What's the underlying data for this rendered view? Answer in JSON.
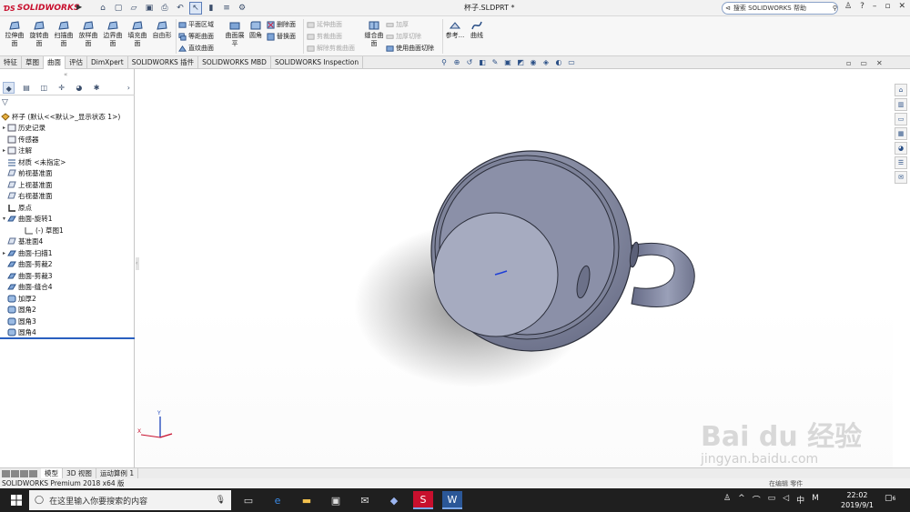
{
  "window": {
    "app_logo": "SOLIDWORKS",
    "doc_title": "杯子.SLDPRT *",
    "help_search_placeholder": "搜索 SOLIDWORKS 帮助"
  },
  "ribbon": {
    "big_buttons": [
      {
        "label": "拉伸曲面",
        "icon": "extrude-surface-icon"
      },
      {
        "label": "旋转曲面",
        "icon": "revolve-surface-icon"
      },
      {
        "label": "扫描曲面",
        "icon": "sweep-surface-icon"
      },
      {
        "label": "放样曲面",
        "icon": "loft-surface-icon"
      },
      {
        "label": "边界曲面",
        "icon": "boundary-surface-icon"
      },
      {
        "label": "填充曲面",
        "icon": "fill-surface-icon"
      },
      {
        "label": "自由形",
        "icon": "freeform-icon"
      }
    ],
    "col1": [
      "平面区域",
      "等距曲面",
      "直纹曲面"
    ],
    "big_mid": [
      {
        "label": "曲面展平",
        "icon": "flatten-surface-icon"
      },
      {
        "label": "圆角",
        "icon": "fillet-icon"
      }
    ],
    "col2": [
      "删除面",
      "替换面"
    ],
    "col3_disabled": [
      "延伸曲面",
      "剪裁曲面",
      "解除剪裁曲面"
    ],
    "big_knit": {
      "label": "缝合曲面",
      "icon": "knit-surface-icon"
    },
    "col4": [
      "加厚",
      "加厚切除",
      "使用曲面切除"
    ],
    "col4_disabled": [
      true,
      true,
      false
    ],
    "big_right": [
      {
        "label": "参考...",
        "icon": "reference-geometry-icon"
      },
      {
        "label": "曲线",
        "icon": "curves-icon"
      }
    ]
  },
  "tabs": [
    "特征",
    "草图",
    "曲面",
    "评估",
    "DimXpert",
    "SOLIDWORKS 插件",
    "SOLIDWORKS MBD",
    "SOLIDWORKS Inspection"
  ],
  "active_tab": "曲面",
  "feature_tree": {
    "root": "杯子 (默认<<默认>_显示状态 1>)",
    "nodes": [
      {
        "label": "历史记录",
        "expand": "▸",
        "indent": 1,
        "icon": "history-icon"
      },
      {
        "label": "传感器",
        "expand": "",
        "indent": 1,
        "icon": "sensor-icon"
      },
      {
        "label": "注解",
        "expand": "▸",
        "indent": 1,
        "icon": "annotation-icon"
      },
      {
        "label": "材质 <未指定>",
        "expand": "",
        "indent": 1,
        "icon": "material-icon"
      },
      {
        "label": "前视基准面",
        "expand": "",
        "indent": 1,
        "icon": "plane-icon"
      },
      {
        "label": "上视基准面",
        "expand": "",
        "indent": 1,
        "icon": "plane-icon"
      },
      {
        "label": "右视基准面",
        "expand": "",
        "indent": 1,
        "icon": "plane-icon"
      },
      {
        "label": "原点",
        "expand": "",
        "indent": 1,
        "icon": "origin-icon"
      },
      {
        "label": "曲面-旋转1",
        "expand": "▾",
        "indent": 1,
        "icon": "revolve-surface-icon"
      },
      {
        "label": "(-) 草图1",
        "expand": "",
        "indent": 2,
        "icon": "sketch-icon"
      },
      {
        "label": "基准面4",
        "expand": "",
        "indent": 1,
        "icon": "plane-icon"
      },
      {
        "label": "曲面-扫描1",
        "expand": "▸",
        "indent": 1,
        "icon": "sweep-surface-icon"
      },
      {
        "label": "曲面-剪裁2",
        "expand": "",
        "indent": 1,
        "icon": "trim-surface-icon"
      },
      {
        "label": "曲面-剪裁3",
        "expand": "",
        "indent": 1,
        "icon": "trim-surface-icon"
      },
      {
        "label": "曲面-缝合4",
        "expand": "",
        "indent": 1,
        "icon": "knit-surface-icon"
      },
      {
        "label": "加厚2",
        "expand": "",
        "indent": 1,
        "icon": "thicken-icon"
      },
      {
        "label": "圆角2",
        "expand": "",
        "indent": 1,
        "icon": "fillet-icon"
      },
      {
        "label": "圆角3",
        "expand": "",
        "indent": 1,
        "icon": "fillet-icon"
      },
      {
        "label": "圆角4",
        "expand": "",
        "indent": 1,
        "icon": "fillet-icon"
      }
    ]
  },
  "model_tabs": [
    "模型",
    "3D 视图",
    "运动算例 1"
  ],
  "active_model_tab": "模型",
  "status_bar": {
    "text": "SOLIDWORKS Premium 2018 x64 版",
    "units": "在编辑 零件"
  },
  "taskbar": {
    "search_placeholder": "在这里输入你要搜索的内容",
    "ime": "中",
    "time": "22:02",
    "date": "2019/9/1",
    "notifications": "6"
  },
  "watermark": {
    "brand": "Bai du 经验",
    "url": "jingyan.baidu.com"
  },
  "colors": {
    "part_body": "#8d93ab",
    "part_dark": "#5d627a",
    "accent": "#2a5fbf",
    "brand": "#c8102e"
  }
}
